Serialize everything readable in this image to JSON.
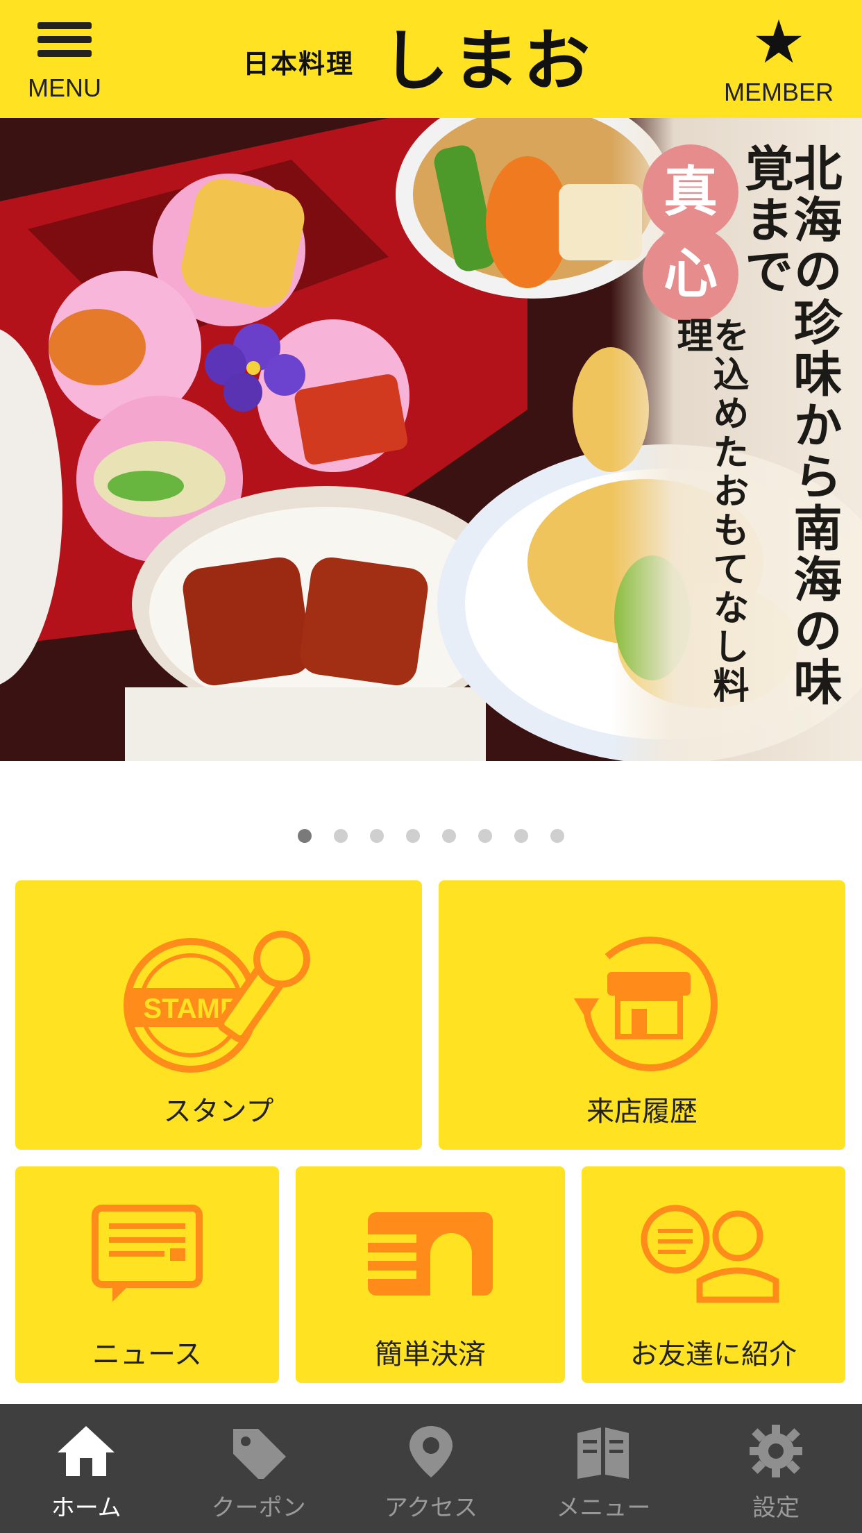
{
  "header": {
    "menu_label": "MENU",
    "brand_small": "日本料理",
    "brand_big": "しまお",
    "member_label": "MEMBER"
  },
  "hero": {
    "seal1": "真",
    "seal2": "心",
    "copy_line1": "北海の珍味から南海の味覚まで",
    "copy_line2": "を込めたおもてなし料理"
  },
  "carousel": {
    "count": 8,
    "active_index": 0
  },
  "tiles": {
    "stamp": {
      "label": "スタンプ",
      "icon_text": "STAMP"
    },
    "history": {
      "label": "来店履歴"
    },
    "news": {
      "label": "ニュース"
    },
    "pay": {
      "label": "簡単決済"
    },
    "friend": {
      "label": "お友達に紹介"
    }
  },
  "tabbar": {
    "home": "ホーム",
    "coupon": "クーポン",
    "access": "アクセス",
    "menu": "メニュー",
    "settings": "設定"
  },
  "colors": {
    "header_bg": "#ffe323",
    "tile_bg": "#ffe323",
    "icon_orange": "#ff8c1a",
    "tabbar_bg": "#3f3f3f"
  }
}
